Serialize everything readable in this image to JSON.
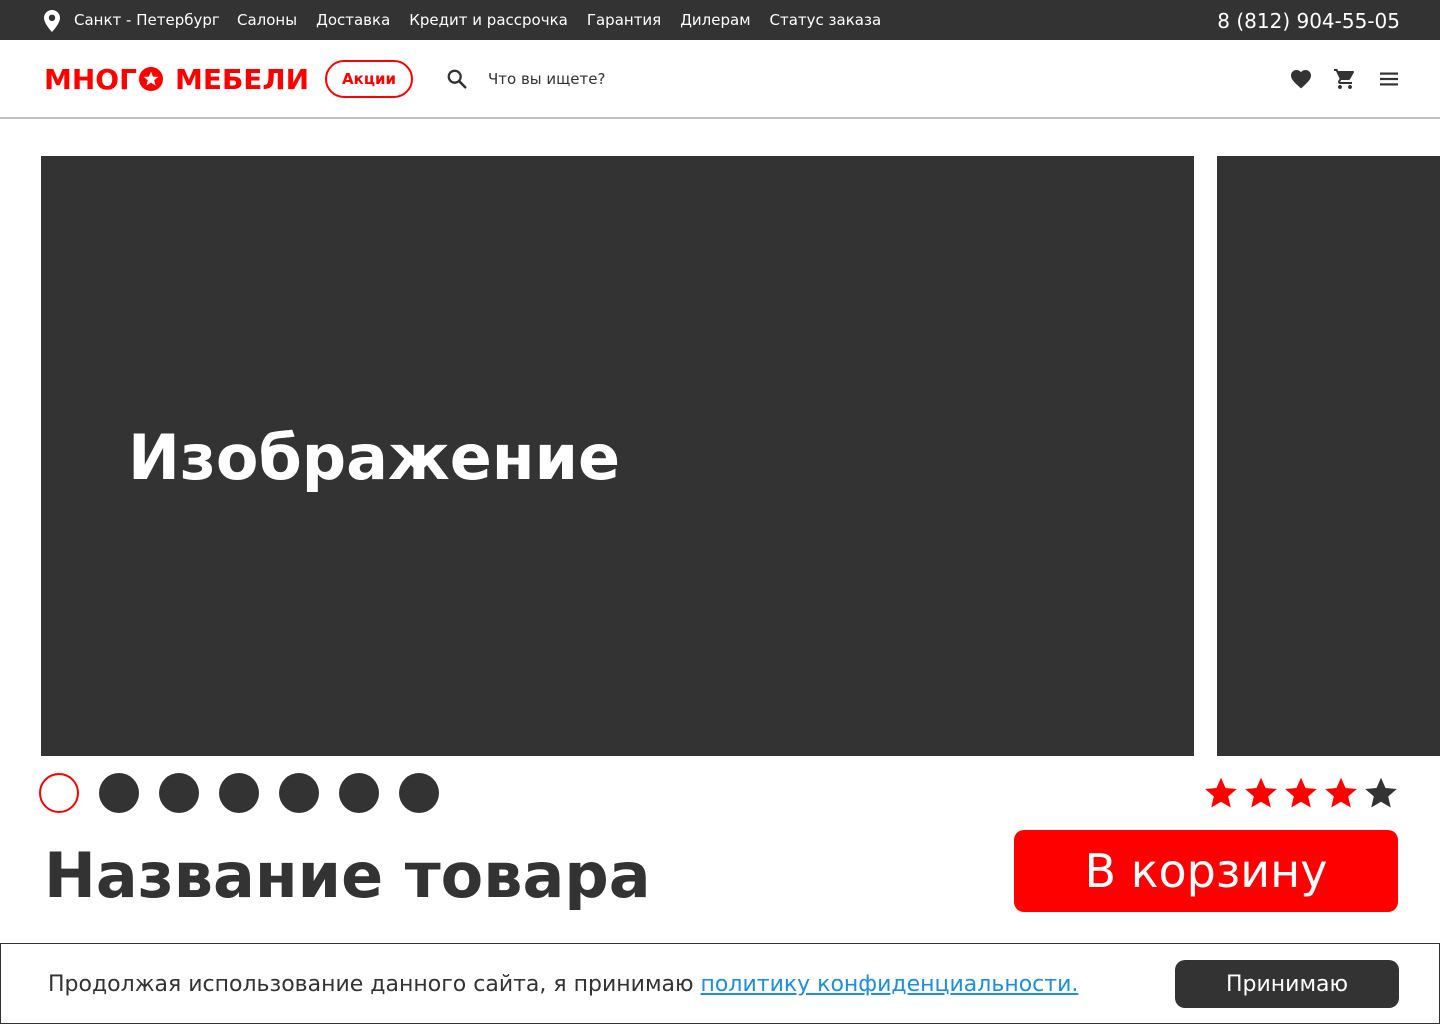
{
  "topbar": {
    "city": "Санкт - Петербург",
    "nav": [
      "Салоны",
      "Доставка",
      "Кредит и рассрочка",
      "Гарантия",
      "Дилерам",
      "Статус заказа"
    ],
    "phone": "8 (812) 904-55-05",
    "pin_icon": "location-pin-icon"
  },
  "header": {
    "logo_part1": "МНОГ",
    "logo_part2": "МЕБЕЛИ",
    "promo_label": "Акции",
    "search_placeholder": "Что вы ищете?",
    "icons": [
      "heart-icon",
      "cart-icon",
      "menu-icon"
    ]
  },
  "gallery": {
    "slide_label": "Изображение",
    "dots_total": 7,
    "active_dot": 1
  },
  "product": {
    "title": "Название товара",
    "rating": 4,
    "rating_max": 5,
    "cart_label": "В корзину"
  },
  "cookie": {
    "text": "Продолжая использование данного сайта, я принимаю ",
    "link_text": "политику конфиденциальности.",
    "accept_label": "Принимаю"
  },
  "colors": {
    "accent": "#ff0000",
    "dark": "#333333",
    "link": "#1a8fe3",
    "star_inactive": "#333333"
  }
}
